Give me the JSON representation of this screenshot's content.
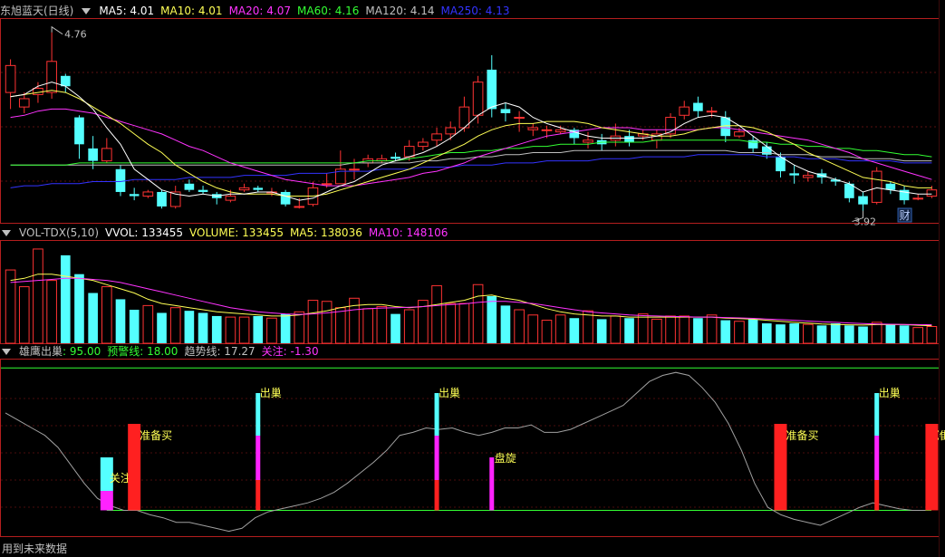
{
  "colors": {
    "bg": "#000000",
    "frame": "#b41e1e",
    "up": "#ff3333",
    "down": "#54ffff",
    "ma5": "#ffffff",
    "ma10": "#ffff55",
    "ma20": "#ff33ff",
    "ma60": "#33ff33",
    "ma120": "#c0c0c0",
    "ma250": "#3333ff",
    "label": "#c0c0c0",
    "white": "#ffffff",
    "red": "#ff2020",
    "cyan": "#54ffff",
    "magenta": "#ff22ff",
    "yellow": "#ffff55",
    "green": "#33ff33"
  },
  "price_panel": {
    "stock_name": "东旭蓝天(日线)",
    "ma5_label": "MA5: 4.01",
    "ma10_label": "MA10: 4.01",
    "ma20_label": "MA20: 4.07",
    "ma60_label": "MA60: 4.16",
    "ma120_label": "MA120: 4.14",
    "ma250_label": "MA250: 4.13",
    "high_mark": "4.76",
    "low_mark": "3.92",
    "event_badge": "财"
  },
  "volume_panel": {
    "title": "VOL-TDX(5,10)",
    "vvol_label": "VVOL: 133455",
    "volume_label": "VOLUME: 133455",
    "ma5_label": "MA5: 138036",
    "ma10_label": "MA10: 148106"
  },
  "indicator_panel": {
    "title": "雄鹰出巢",
    "value_label": ": 95.00",
    "warning_label": "预警线: 18.00",
    "trend_label": "趋势线: 17.27",
    "focus_label": "关注: -1.30"
  },
  "footer_text": "用到未来数据",
  "chart_data": [
    {
      "type": "candlestick",
      "ylim": [
        3.85,
        4.82
      ],
      "ma_names": [
        "MA5",
        "MA10",
        "MA20",
        "MA60",
        "MA120",
        "MA250"
      ],
      "candles": [
        [
          4.47,
          4.6,
          4.63,
          4.39
        ],
        [
          4.4,
          4.44,
          4.47,
          4.37
        ],
        [
          4.46,
          4.49,
          4.52,
          4.42
        ],
        [
          4.47,
          4.62,
          4.76,
          4.44
        ],
        [
          4.55,
          4.5,
          4.56,
          4.47
        ],
        [
          4.35,
          4.22,
          4.36,
          4.15
        ],
        [
          4.2,
          4.14,
          4.26,
          4.1
        ],
        [
          4.14,
          4.2,
          4.25,
          4.13
        ],
        [
          4.1,
          3.99,
          4.12,
          3.97
        ],
        [
          3.98,
          3.97,
          4.01,
          3.95
        ],
        [
          3.97,
          3.99,
          4,
          3.96
        ],
        [
          3.99,
          3.92,
          4,
          3.91
        ],
        [
          3.92,
          3.99,
          4.02,
          3.91
        ],
        [
          4.03,
          4.0,
          4.05,
          3.99
        ],
        [
          4,
          3.99,
          4.02,
          3.98
        ],
        [
          3.98,
          3.96,
          3.99,
          3.93
        ],
        [
          3.95,
          3.97,
          4,
          3.94
        ],
        [
          4.0,
          4.01,
          4.03,
          3.99
        ],
        [
          4.01,
          4.0,
          4.02,
          3.99
        ],
        [
          3.99,
          3.99,
          4.01,
          3.97
        ],
        [
          3.99,
          3.93,
          4,
          3.92
        ],
        [
          3.92,
          3.92,
          3.96,
          3.91
        ],
        [
          3.93,
          4.01,
          4.04,
          3.92
        ],
        [
          4.03,
          4.03,
          4.08,
          4.01
        ],
        [
          4.03,
          4.1,
          4.19,
          4.03
        ],
        [
          4.1,
          4.1,
          4.15,
          4.05
        ],
        [
          4.13,
          4.15,
          4.17,
          4.11
        ],
        [
          4.14,
          4.15,
          4.17,
          4.13
        ],
        [
          4.16,
          4.15,
          4.18,
          4.14
        ],
        [
          4.16,
          4.21,
          4.24,
          4.14
        ],
        [
          4.21,
          4.23,
          4.25,
          4.19
        ],
        [
          4.24,
          4.27,
          4.3,
          4.21
        ],
        [
          4.27,
          4.3,
          4.33,
          4.24
        ],
        [
          4.3,
          4.4,
          4.45,
          4.28
        ],
        [
          4.36,
          4.52,
          4.55,
          4.32
        ],
        [
          4.58,
          4.39,
          4.65,
          4.35
        ],
        [
          4.39,
          4.37,
          4.42,
          4.33
        ],
        [
          4.35,
          4.35,
          4.38,
          4.28
        ],
        [
          4.29,
          4.3,
          4.32,
          4.26
        ],
        [
          4.29,
          4.29,
          4.31,
          4.25
        ],
        [
          4.28,
          4.29,
          4.31,
          4.27
        ],
        [
          4.29,
          4.25,
          4.3,
          4.22
        ],
        [
          4.23,
          4.24,
          4.28,
          4.2
        ],
        [
          4.24,
          4.22,
          4.27,
          4.19
        ],
        [
          4.24,
          4.26,
          4.32,
          4.21
        ],
        [
          4.26,
          4.23,
          4.29,
          4.21
        ],
        [
          4.26,
          4.27,
          4.29,
          4.24
        ],
        [
          4.24,
          4.27,
          4.29,
          4.2
        ],
        [
          4.27,
          4.35,
          4.37,
          4.25
        ],
        [
          4.36,
          4.4,
          4.43,
          4.34
        ],
        [
          4.42,
          4.38,
          4.45,
          4.35
        ],
        [
          4.38,
          4.38,
          4.4,
          4.35
        ],
        [
          4.35,
          4.26,
          4.38,
          4.23
        ],
        [
          4.26,
          4.28,
          4.3,
          4.25
        ],
        [
          4.24,
          4.2,
          4.26,
          4.18
        ],
        [
          4.21,
          4.17,
          4.23,
          4.15
        ],
        [
          4.16,
          4.09,
          4.18,
          4.06
        ],
        [
          4.08,
          4.07,
          4.12,
          4.03
        ],
        [
          4.06,
          4.07,
          4.09,
          4.04
        ],
        [
          4.08,
          4.06,
          4.1,
          4.03
        ],
        [
          4.05,
          4.04,
          4.06,
          4.02
        ],
        [
          4.03,
          3.96,
          4.04,
          3.94
        ],
        [
          3.97,
          3.93,
          3.99,
          3.9
        ],
        [
          3.94,
          4.09,
          4.11,
          3.93
        ],
        [
          4.03,
          4.0,
          4.04,
          3.98
        ],
        [
          4.0,
          3.95,
          4.02,
          3.93
        ],
        [
          3.96,
          3.96,
          3.98,
          3.95
        ],
        [
          3.97,
          4,
          4.02,
          3.96
        ]
      ],
      "ma5": [
        4.45,
        4.46,
        4.5,
        4.52,
        4.5,
        4.45,
        4.39,
        4.3,
        4.22,
        4.1,
        4.05,
        4.0,
        3.98,
        3.97,
        3.98,
        3.97,
        3.98,
        3.98,
        3.99,
        3.99,
        3.97,
        3.95,
        3.96,
        3.99,
        4.02,
        4.04,
        4.08,
        4.12,
        4.14,
        4.16,
        4.18,
        4.21,
        4.25,
        4.3,
        4.36,
        4.4,
        4.42,
        4.4,
        4.35,
        4.32,
        4.3,
        4.28,
        4.26,
        4.25,
        4.25,
        4.25,
        4.25,
        4.26,
        4.28,
        4.32,
        4.35,
        4.36,
        4.35,
        4.31,
        4.26,
        4.21,
        4.16,
        4.12,
        4.09,
        4.07,
        4.05,
        4.03,
        3.99,
        4.01,
        4.0,
        3.99,
        3.98,
        3.98
      ],
      "ma10": [
        4.45,
        4.46,
        4.47,
        4.48,
        4.47,
        4.44,
        4.4,
        4.36,
        4.32,
        4.27,
        4.22,
        4.18,
        4.12,
        4.08,
        4.04,
        4.01,
        3.99,
        3.98,
        3.98,
        3.98,
        3.97,
        3.97,
        3.97,
        3.98,
        4.0,
        4.02,
        4.04,
        4.06,
        4.08,
        4.1,
        4.13,
        4.16,
        4.19,
        4.22,
        4.26,
        4.29,
        4.31,
        4.32,
        4.32,
        4.33,
        4.33,
        4.33,
        4.32,
        4.3,
        4.29,
        4.28,
        4.27,
        4.26,
        4.26,
        4.27,
        4.29,
        4.3,
        4.31,
        4.31,
        4.3,
        4.28,
        4.25,
        4.22,
        4.18,
        4.15,
        4.12,
        4.09,
        4.06,
        4.05,
        4.04,
        4.02,
        4.01,
        4.01
      ],
      "ma20": [
        4.35,
        4.36,
        4.38,
        4.39,
        4.39,
        4.38,
        4.37,
        4.35,
        4.33,
        4.31,
        4.29,
        4.27,
        4.24,
        4.21,
        4.19,
        4.16,
        4.13,
        4.11,
        4.09,
        4.07,
        4.05,
        4.04,
        4.03,
        4.02,
        4.02,
        4.02,
        4.03,
        4.04,
        4.05,
        4.06,
        4.08,
        4.09,
        4.11,
        4.13,
        4.16,
        4.18,
        4.2,
        4.22,
        4.24,
        4.26,
        4.27,
        4.28,
        4.29,
        4.3,
        4.3,
        4.3,
        4.29,
        4.29,
        4.29,
        4.29,
        4.29,
        4.3,
        4.3,
        4.29,
        4.28,
        4.27,
        4.26,
        4.25,
        4.24,
        4.22,
        4.2,
        4.18,
        4.15,
        4.13,
        4.11,
        4.09,
        4.07,
        4.05
      ],
      "ma60": [
        4.12,
        4.12,
        4.12,
        4.12,
        4.12,
        4.13,
        4.13,
        4.13,
        4.13,
        4.13,
        4.13,
        4.13,
        4.13,
        4.13,
        4.13,
        4.13,
        4.13,
        4.13,
        4.13,
        4.13,
        4.13,
        4.13,
        4.13,
        4.13,
        4.13,
        4.13,
        4.14,
        4.14,
        4.14,
        4.15,
        4.16,
        4.17,
        4.18,
        4.18,
        4.19,
        4.19,
        4.2,
        4.2,
        4.21,
        4.21,
        4.22,
        4.22,
        4.22,
        4.23,
        4.23,
        4.23,
        4.23,
        4.24,
        4.24,
        4.24,
        4.24,
        4.24,
        4.24,
        4.24,
        4.23,
        4.23,
        4.22,
        4.22,
        4.21,
        4.21,
        4.2,
        4.2,
        4.19,
        4.19,
        4.18,
        4.17,
        4.17,
        4.16
      ],
      "ma120": [
        4.12,
        4.12,
        4.12,
        4.12,
        4.12,
        4.12,
        4.12,
        4.12,
        4.12,
        4.12,
        4.12,
        4.12,
        4.12,
        4.12,
        4.12,
        4.12,
        4.12,
        4.12,
        4.12,
        4.12,
        4.12,
        4.12,
        4.12,
        4.12,
        4.12,
        4.13,
        4.13,
        4.13,
        4.13,
        4.13,
        4.14,
        4.14,
        4.15,
        4.15,
        4.16,
        4.16,
        4.17,
        4.17,
        4.18,
        4.18,
        4.18,
        4.19,
        4.19,
        4.19,
        4.19,
        4.19,
        4.19,
        4.19,
        4.19,
        4.19,
        4.19,
        4.19,
        4.19,
        4.18,
        4.18,
        4.18,
        4.17,
        4.17,
        4.17,
        4.16,
        4.16,
        4.16,
        4.15,
        4.15,
        4.15,
        4.14,
        4.14,
        4.14
      ],
      "ma250": [
        4.01,
        4.02,
        4.02,
        4.03,
        4.03,
        4.03,
        4.04,
        4.04,
        4.04,
        4.05,
        4.05,
        4.05,
        4.05,
        4.06,
        4.06,
        4.06,
        4.06,
        4.07,
        4.07,
        4.07,
        4.07,
        4.08,
        4.08,
        4.08,
        4.09,
        4.09,
        4.09,
        4.1,
        4.1,
        4.1,
        4.11,
        4.11,
        4.11,
        4.12,
        4.12,
        4.12,
        4.13,
        4.13,
        4.13,
        4.14,
        4.14,
        4.14,
        4.14,
        4.15,
        4.15,
        4.15,
        4.16,
        4.16,
        4.16,
        4.16,
        4.17,
        4.17,
        4.17,
        4.17,
        4.17,
        4.16,
        4.16,
        4.16,
        4.15,
        4.15,
        4.15,
        4.14,
        4.14,
        4.14,
        4.14,
        4.13,
        4.13,
        4.13
      ],
      "high_index": 3,
      "low_index": 62
    },
    {
      "type": "bar",
      "ylim": [
        0,
        480000
      ],
      "volume": [
        350000,
        270000,
        450000,
        300000,
        420000,
        330000,
        240000,
        270000,
        210000,
        160000,
        180000,
        145000,
        170000,
        155000,
        145000,
        130000,
        125000,
        125000,
        130000,
        120000,
        140000,
        150000,
        205000,
        200000,
        170000,
        215000,
        165000,
        175000,
        140000,
        160000,
        205000,
        275000,
        190000,
        190000,
        280000,
        225000,
        180000,
        160000,
        135000,
        110000,
        135000,
        120000,
        155000,
        115000,
        130000,
        120000,
        140000,
        115000,
        130000,
        130000,
        120000,
        135000,
        110000,
        105000,
        115000,
        95000,
        90000,
        95000,
        90000,
        85000,
        95000,
        85000,
        80000,
        100000,
        90000,
        85000,
        75000,
        80000
      ],
      "ma5": [
        300000,
        310000,
        330000,
        330000,
        320000,
        310000,
        300000,
        280000,
        260000,
        240000,
        210000,
        190000,
        180000,
        170000,
        160000,
        150000,
        145000,
        140000,
        135000,
        130000,
        130000,
        135000,
        145000,
        155000,
        170000,
        180000,
        185000,
        185000,
        175000,
        170000,
        175000,
        185000,
        195000,
        205000,
        225000,
        230000,
        215000,
        205000,
        185000,
        165000,
        150000,
        140000,
        135000,
        130000,
        130000,
        125000,
        125000,
        125000,
        125000,
        125000,
        125000,
        125000,
        120000,
        118000,
        115000,
        110000,
        105000,
        100000,
        96000,
        92000,
        90000,
        88000,
        87000,
        89000,
        90000,
        89000,
        86000,
        84000
      ],
      "ma10": [
        290000,
        295000,
        300000,
        305000,
        310000,
        310000,
        305000,
        300000,
        290000,
        275000,
        260000,
        245000,
        230000,
        215000,
        200000,
        185000,
        170000,
        160000,
        150000,
        145000,
        140000,
        138000,
        140000,
        145000,
        152000,
        160000,
        165000,
        168000,
        170000,
        172000,
        175000,
        180000,
        185000,
        188000,
        195000,
        200000,
        200000,
        195000,
        190000,
        180000,
        170000,
        160000,
        150000,
        145000,
        140000,
        135000,
        132000,
        130000,
        128000,
        127000,
        125000,
        125000,
        123000,
        121000,
        119000,
        116000,
        113000,
        110000,
        106000,
        103000,
        100000,
        97000,
        94000,
        92000,
        91000,
        90000,
        89000,
        88000
      ]
    },
    {
      "type": "line",
      "ylim": [
        -10,
        100
      ],
      "ref_line": 95.0,
      "zero_line": 0,
      "trend": [
        65,
        60,
        55,
        50,
        42,
        30,
        18,
        8,
        3,
        0,
        0,
        -3,
        -5,
        -8,
        -8,
        -10,
        -12,
        -14,
        -12,
        -5,
        -1,
        1,
        3,
        5,
        8,
        12,
        18,
        25,
        32,
        40,
        50,
        52,
        55,
        54,
        55,
        52,
        50,
        52,
        55,
        55,
        57,
        52,
        52,
        54,
        58,
        62,
        66,
        70,
        78,
        86,
        90,
        92,
        90,
        82,
        72,
        58,
        40,
        18,
        2,
        -3,
        -6,
        -8,
        -10,
        -6,
        -2,
        2,
        5,
        3,
        1,
        0,
        0
      ],
      "signals": [
        {
          "index": 7,
          "kind": "focus",
          "label": "关注"
        },
        {
          "index": 9,
          "kind": "ready",
          "label": "准备买"
        },
        {
          "index": 18,
          "kind": "exit",
          "label": "出巢"
        },
        {
          "index": 31,
          "kind": "exit",
          "label": "出巢"
        },
        {
          "index": 35,
          "kind": "spiral",
          "label": "盘旋"
        },
        {
          "index": 56,
          "kind": "ready",
          "label": "准备买"
        },
        {
          "index": 63,
          "kind": "exit",
          "label": "出巢"
        },
        {
          "index": 67,
          "kind": "ready",
          "label": "准备买"
        }
      ]
    }
  ]
}
